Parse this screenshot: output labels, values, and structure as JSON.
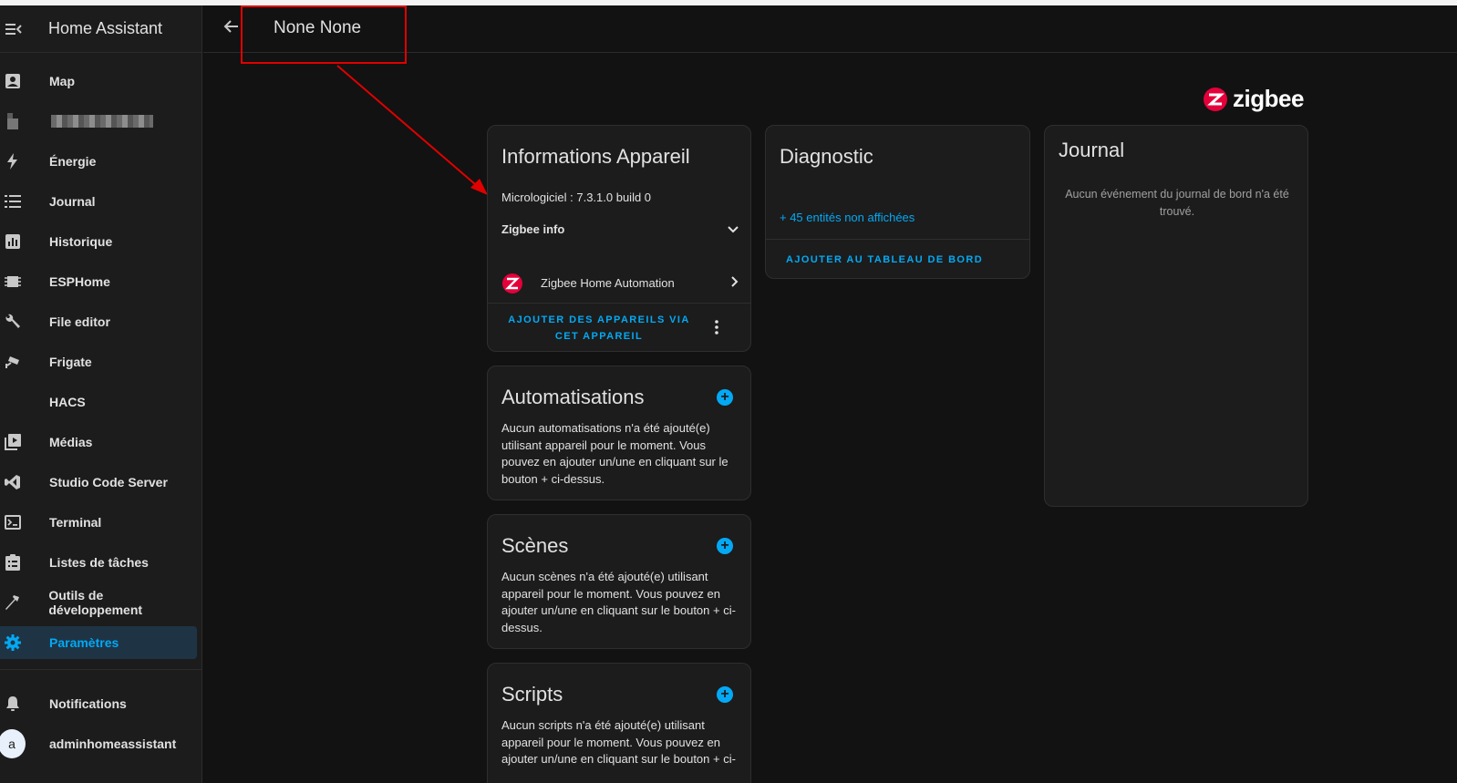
{
  "app": {
    "title": "Home Assistant"
  },
  "page": {
    "title": "None None"
  },
  "sidebar": {
    "items": [
      {
        "label": "Map",
        "icon": "account-box-icon"
      },
      {
        "label": "",
        "icon": "blurred-icon"
      },
      {
        "label": "Énergie",
        "icon": "lightning-icon"
      },
      {
        "label": "Journal",
        "icon": "list-icon"
      },
      {
        "label": "Historique",
        "icon": "chart-box-icon"
      },
      {
        "label": "ESPHome",
        "icon": "chip-icon"
      },
      {
        "label": "File editor",
        "icon": "wrench-icon"
      },
      {
        "label": "Frigate",
        "icon": "cctv-icon"
      },
      {
        "label": "HACS",
        "icon": ""
      },
      {
        "label": "Médias",
        "icon": "play-box-icon"
      },
      {
        "label": "Studio Code Server",
        "icon": "vscode-icon"
      },
      {
        "label": "Terminal",
        "icon": "console-icon"
      },
      {
        "label": "Listes de tâches",
        "icon": "clipboard-list-icon"
      },
      {
        "label": "Outils de développement",
        "icon": "hammer-icon"
      },
      {
        "label": "Paramètres",
        "icon": "gear-icon"
      }
    ],
    "notifications": "Notifications",
    "user": {
      "initial": "a",
      "name": "adminhomeassistant"
    }
  },
  "brand": {
    "logo_text": "zigbee"
  },
  "device_info": {
    "title": "Informations Appareil",
    "firmware": "Micrologiciel : 7.3.1.0 build 0",
    "zigbee_info": "Zigbee info",
    "integration": "Zigbee Home Automation",
    "add_devices_line1": "AJOUTER DES APPAREILS VIA",
    "add_devices_line2": "CET APPAREIL"
  },
  "diagnostic": {
    "title": "Diagnostic",
    "hidden_entities": "+ 45 entités non affichées",
    "add_to_dashboard": "AJOUTER AU TABLEAU DE BORD"
  },
  "journal": {
    "title": "Journal",
    "empty_line1": "Aucun événement du journal de bord n'a été",
    "empty_line2": "trouvé."
  },
  "automations": {
    "title": "Automatisations",
    "text": [
      "Aucun automatisations n'a été ajouté(e)",
      "utilisant appareil pour le moment. Vous",
      "pouvez en ajouter un/une en cliquant sur le",
      "bouton + ci-dessus."
    ]
  },
  "scenes": {
    "title": "Scènes",
    "text": [
      "Aucun scènes n'a été ajouté(e) utilisant",
      "appareil pour le moment. Vous pouvez en",
      "ajouter un/une en cliquant sur le bouton + ci-",
      "dessus."
    ]
  },
  "scripts": {
    "title": "Scripts",
    "text": [
      "Aucun scripts n'a été ajouté(e) utilisant",
      "appareil pour le moment. Vous pouvez en",
      "ajouter un/une en cliquant sur le bouton + ci-"
    ]
  },
  "colors": {
    "accent": "#03a9f4",
    "annotation": "#e00000",
    "zigbee": "#e4003a"
  }
}
